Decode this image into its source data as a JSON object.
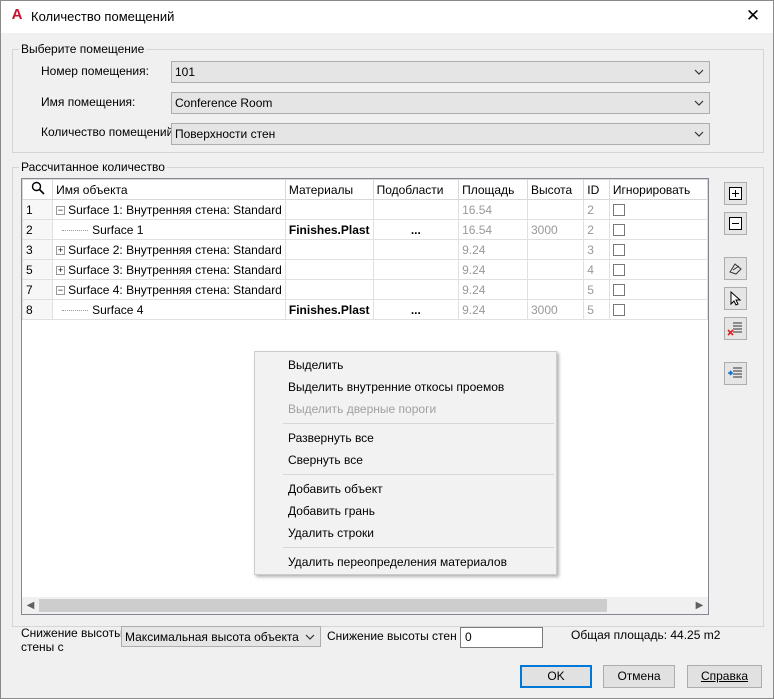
{
  "window": {
    "title": "Количество помещений"
  },
  "select_group": {
    "legend": "Выберите помещение",
    "room_number_label": "Номер помещения:",
    "room_number_value": "101",
    "room_name_label": "Имя помещения:",
    "room_name_value": "Conference Room",
    "quantity_label": "Количество помещений:",
    "quantity_value": "Поверхности стен"
  },
  "calc_group": {
    "legend": "Рассчитанное количество"
  },
  "table": {
    "headers": [
      "Имя объекта",
      "Материалы",
      "Подобласти",
      "Площадь",
      "Высота",
      "ID",
      "Игнорировать"
    ],
    "rows": [
      {
        "num": "1",
        "expander": "−",
        "name": "Surface 1: Внутренняя стена: Standard",
        "material": "",
        "sub": "",
        "area": "16.54",
        "height": "",
        "id": "2"
      },
      {
        "num": "2",
        "expander": "",
        "name": "Surface 1",
        "material": "Finishes.Plast",
        "sub": "...",
        "area": "16.54",
        "height": "3000",
        "id": "2"
      },
      {
        "num": "3",
        "expander": "+",
        "name": "Surface 2: Внутренняя стена: Standard",
        "material": "",
        "sub": "",
        "area": "9.24",
        "height": "",
        "id": "3"
      },
      {
        "num": "5",
        "expander": "+",
        "name": "Surface 3: Внутренняя стена: Standard",
        "material": "",
        "sub": "",
        "area": "9.24",
        "height": "",
        "id": "4"
      },
      {
        "num": "7",
        "expander": "−",
        "name": "Surface 4: Внутренняя стена: Standard",
        "material": "",
        "sub": "",
        "area": "9.24",
        "height": "",
        "id": "5"
      },
      {
        "num": "8",
        "expander": "",
        "name": "Surface 4",
        "material": "Finishes.Plast",
        "sub": "...",
        "area": "9.24",
        "height": "3000",
        "id": "5"
      }
    ]
  },
  "context_menu": {
    "select": "Выделить",
    "select_reveals": "Выделить внутренние откосы проемов",
    "select_sills": "Выделить дверные пороги",
    "expand_all": "Развернуть все",
    "collapse_all": "Свернуть все",
    "add_object": "Добавить объект",
    "add_face": "Добавить грань",
    "delete_rows": "Удалить строки",
    "delete_overrides": "Удалить переопределения материалов"
  },
  "bottom": {
    "wall_reduction_label_1": "Снижение высоты",
    "wall_reduction_label_2": "стены с",
    "wall_reduction_value": "Максимальная высота объекта",
    "wall_height_reduction_label": "Снижение высоты стен",
    "wall_height_reduction_value": "0",
    "total_area": "Общая площадь: 44.25 m2"
  },
  "buttons": {
    "ok": "OK",
    "cancel": "Отмена",
    "help": "Справка"
  }
}
